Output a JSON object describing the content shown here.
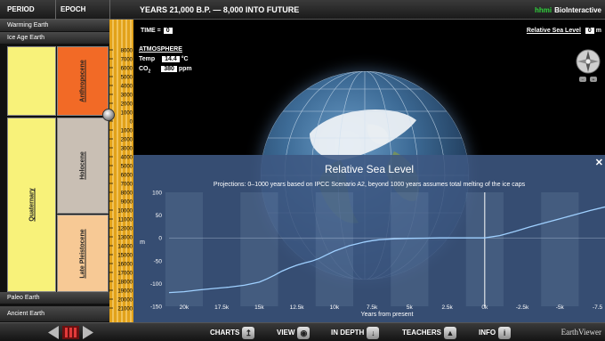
{
  "header": {
    "period": "PERIOD",
    "epoch": "EPOCH",
    "years": "YEARS 21,000 B.P. — 8,000 INTO FUTURE",
    "brand_hhmi": "hhmi",
    "brand_name": "BioInteractive"
  },
  "left_panel": {
    "top_bars": [
      "Warming Earth",
      "Ice Age Earth"
    ],
    "bottom_bars": [
      "Paleo Earth",
      "Ancient Earth"
    ],
    "period": "Quaternary",
    "epochs": [
      "Anthropocene",
      "Holocene",
      "Late Pleistocene"
    ],
    "colors": {
      "anthropocene": "#f26a26",
      "holocene": "#c9bfb4",
      "pleistocene": "#f7c995",
      "period": "#f8f27a"
    }
  },
  "ruler": {
    "ticks": [
      "8000",
      "7000",
      "6000",
      "5000",
      "4000",
      "3000",
      "2000",
      "1000",
      "0",
      "1000",
      "2000",
      "3000",
      "4000",
      "5000",
      "6000",
      "7000",
      "8000",
      "9000",
      "10000",
      "11000",
      "12000",
      "13000",
      "14000",
      "15000",
      "16000",
      "17000",
      "18000",
      "19000",
      "20000",
      "21000"
    ]
  },
  "stage": {
    "time_label": "TIME =",
    "time_value": "0",
    "atmosphere_title": "ATMOSPHERE",
    "temp_label": "Temp",
    "temp_value": "14.4",
    "temp_unit": "°C",
    "co2_label": "CO",
    "co2_sub": "2",
    "co2_value": "380",
    "co2_unit": "ppm",
    "rsl_label": "Relative Sea Level",
    "rsl_value": "0",
    "rsl_unit": "m"
  },
  "chart_data": {
    "type": "line",
    "title": "Relative Sea Level",
    "subtitle": "Projections: 0–1000 years based on IPCC Scenario A2, beyond 1000 years assumes total melting of the ice caps",
    "xlabel": "Years from present",
    "ylabel": "m",
    "xlim": [
      21000,
      -8000
    ],
    "ylim": [
      -150,
      100
    ],
    "x_ticks": [
      {
        "v": 20000,
        "label": "20k"
      },
      {
        "v": 17500,
        "label": "17.5k"
      },
      {
        "v": 15000,
        "label": "15k"
      },
      {
        "v": 12500,
        "label": "12.5k"
      },
      {
        "v": 10000,
        "label": "10k"
      },
      {
        "v": 7500,
        "label": "7.5k"
      },
      {
        "v": 5000,
        "label": "5k"
      },
      {
        "v": 2500,
        "label": "2.5k"
      },
      {
        "v": 0,
        "label": "0k"
      },
      {
        "v": -2500,
        "label": "-2.5k"
      },
      {
        "v": -5000,
        "label": "-5k"
      },
      {
        "v": -7500,
        "label": "-7.5"
      }
    ],
    "y_ticks": [
      100,
      50,
      0,
      -50,
      -100,
      -150
    ],
    "series": [
      {
        "x": [
          21000,
          20000,
          19000,
          18000,
          17000,
          16000,
          15000,
          14500,
          14000,
          13500,
          13000,
          12500,
          12000,
          11500,
          11000,
          10500,
          10000,
          9500,
          9000,
          8500,
          8000,
          7500,
          7000,
          6000,
          5000,
          4000,
          3000,
          2000,
          1000,
          0,
          -1000,
          -2000,
          -3000,
          -4000,
          -5000,
          -6000,
          -7000,
          -8000
        ],
        "y": [
          -120,
          -118,
          -114,
          -111,
          -108,
          -104,
          -97,
          -90,
          -82,
          -73,
          -66,
          -60,
          -55,
          -51,
          -45,
          -37,
          -29,
          -23,
          -17,
          -13,
          -9,
          -6,
          -4,
          -2,
          -1,
          -0.5,
          0,
          0,
          0,
          0,
          5,
          14,
          24,
          33,
          42,
          51,
          60,
          68
        ]
      }
    ],
    "current_time": 0,
    "band_color": "#9fb6d6"
  },
  "bottom": {
    "buttons": [
      {
        "label": "CHARTS"
      },
      {
        "label": "VIEW"
      },
      {
        "label": "IN DEPTH"
      },
      {
        "label": "TEACHERS"
      },
      {
        "label": "INFO"
      }
    ],
    "footer": "EarthViewer"
  }
}
